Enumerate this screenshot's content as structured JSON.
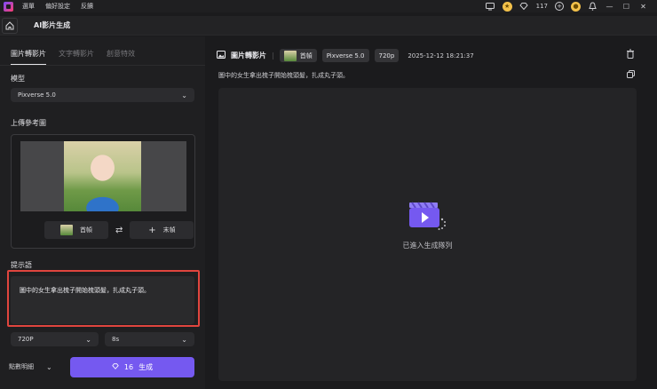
{
  "titlebar": {
    "menu": [
      "選單",
      "偏好設定",
      "反饋"
    ],
    "credits": "117"
  },
  "header": {
    "title": "AI影片生成"
  },
  "left": {
    "tabs": [
      {
        "label": "圖片轉影片",
        "active": true
      },
      {
        "label": "文字轉影片",
        "active": false
      },
      {
        "label": "創意特效",
        "active": false
      }
    ],
    "model_label": "模型",
    "model_value": "Pixverse 5.0",
    "upload_label": "上傳參考圖",
    "first_frame": "首幀",
    "last_frame": "末幀",
    "prompt_label": "提示語",
    "prompt_text": "圖中的女生拿出梳子開始梳頭髮，扎成丸子頭。",
    "resolution": "720P",
    "duration": "8s",
    "details": "點數明細",
    "generate_cost": "16",
    "generate_label": "生成"
  },
  "right": {
    "title": "圖片轉影片",
    "chip_frame": "首幀",
    "chip_model": "Pixverse 5.0",
    "chip_res": "720p",
    "timestamp": "2025-12-12 18:21:37",
    "prompt": "圖中的女生拿出梳子開始梳頭髮，扎成丸子頭。",
    "status": "已進入生成隊列"
  },
  "colors": {
    "accent": "#7559f0",
    "highlight": "#e0453e"
  }
}
